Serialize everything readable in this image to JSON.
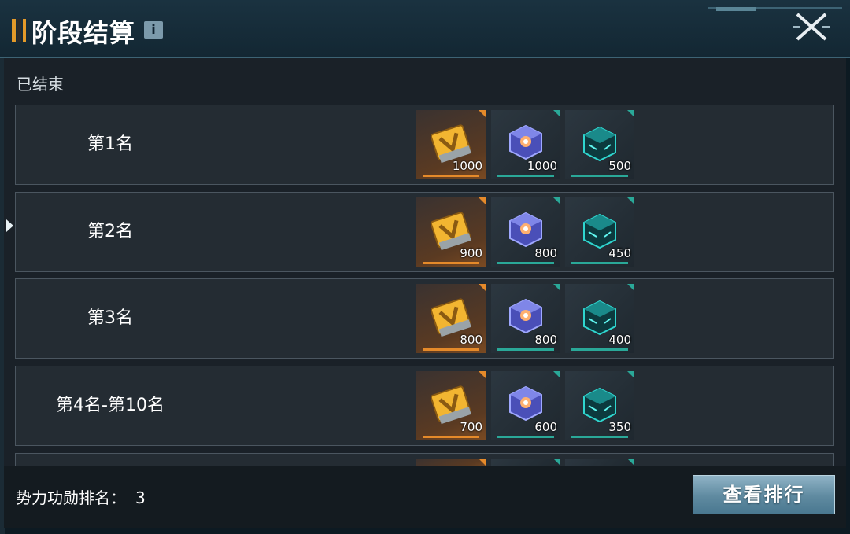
{
  "header": {
    "title": "阶段结算",
    "info_label": "i"
  },
  "status_text": "已结束",
  "rows": [
    {
      "rank": "第1名",
      "rewards": [
        "1000",
        "1000",
        "500"
      ]
    },
    {
      "rank": "第2名",
      "rewards": [
        "900",
        "800",
        "450"
      ]
    },
    {
      "rank": "第3名",
      "rewards": [
        "800",
        "800",
        "400"
      ]
    },
    {
      "rank": "第4名-第10名",
      "rewards": [
        "700",
        "600",
        "350"
      ]
    }
  ],
  "reward_icons": [
    "gold-voucher-icon",
    "purple-crystal-cube-icon",
    "teal-circuit-cube-icon"
  ],
  "footer": {
    "merit_label": "势力功勋排名：",
    "merit_value": "3",
    "view_button": "查看排行"
  },
  "colors": {
    "accent_orange": "#e58a2a",
    "accent_teal": "#2aa898",
    "button_blue": "#6f97ab"
  }
}
